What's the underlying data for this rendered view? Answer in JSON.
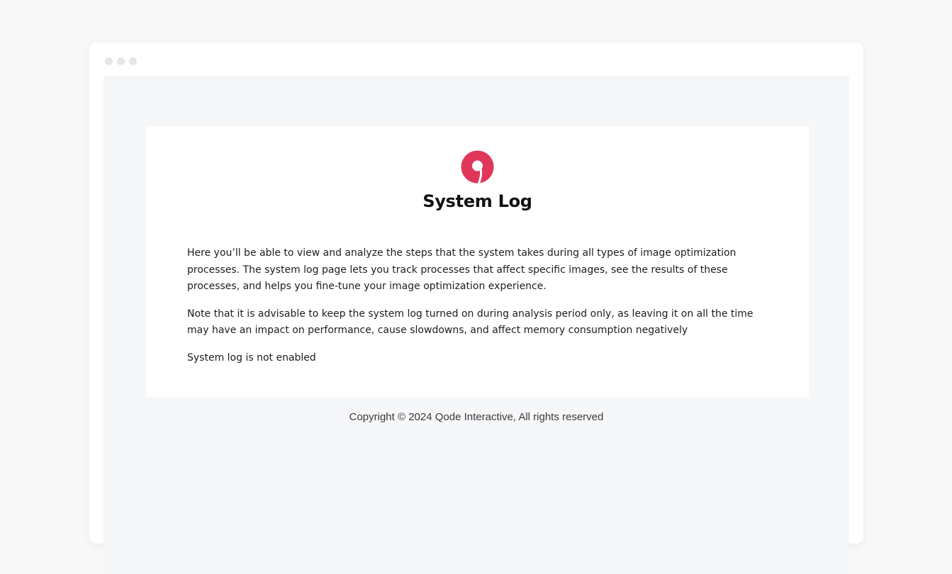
{
  "window": {
    "traffic_lights": [
      "window-dot",
      "window-dot",
      "window-dot"
    ]
  },
  "page": {
    "logo_icon": "qode-logo-icon",
    "brand_color": "#e0365a",
    "title": "System Log",
    "paragraphs": [
      "Here you’ll be able to view and analyze the steps that the system takes during all types of image optimization processes. The system log page lets you track processes that affect specific images, see the results of these processes, and helps you fine-tune your image optimization experience.",
      "Note that it is advisable to keep the system log turned on during analysis period only, as leaving it on all the time may have an impact on performance, cause slowdowns, and affect memory consumption negatively"
    ],
    "status": "System log is not enabled"
  },
  "footer": {
    "copyright": "Copyright © 2024 Qode Interactive, All rights reserved"
  }
}
